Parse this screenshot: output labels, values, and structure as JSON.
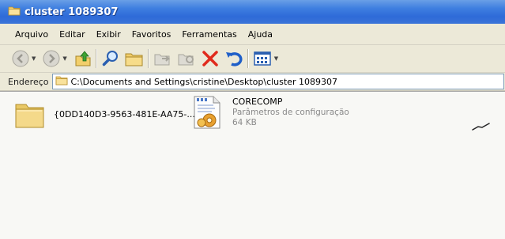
{
  "window": {
    "title": "cluster 1089307"
  },
  "menu": [
    "Arquivo",
    "Editar",
    "Exibir",
    "Favoritos",
    "Ferramentas",
    "Ajuda"
  ],
  "toolbar": {
    "icons": [
      "back-icon",
      "forward-icon",
      "up-folder-icon",
      "search-icon",
      "folders-icon",
      "move-to-icon",
      "copy-to-icon",
      "delete-icon",
      "undo-icon",
      "views-icon"
    ]
  },
  "address": {
    "label": "Endereço",
    "path": "C:\\Documents and Settings\\cristine\\Desktop\\cluster 1089307"
  },
  "files": [
    {
      "name": "{0DD140D3-9563-481E-AA75-...",
      "type": "",
      "size": "",
      "icon": "folder-icon"
    },
    {
      "name": "CORECOMP",
      "type": "Parâmetros de configuração",
      "size": "64 KB",
      "icon": "config-file-icon"
    }
  ]
}
